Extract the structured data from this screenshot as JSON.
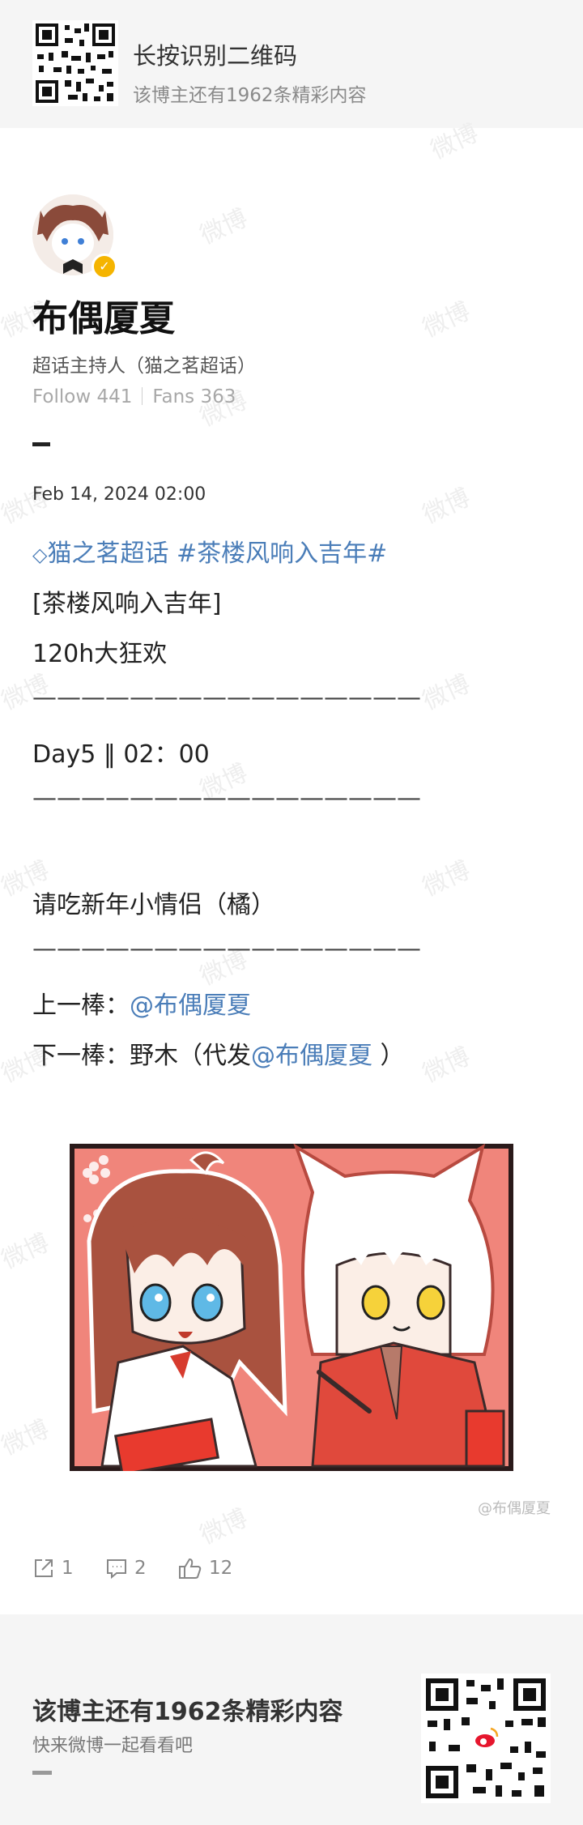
{
  "banner": {
    "title": "长按识别二维码",
    "subtitle": "该博主还有1962条精彩内容"
  },
  "watermark_text": "微博",
  "profile": {
    "name": "布偶厦夏",
    "role": "超话主持人（猫之茗超话）",
    "follow": "Follow 441",
    "fans": "Fans 363",
    "verified_icon": "verified-badge-icon"
  },
  "post": {
    "date": "Feb 14, 2024 02:00",
    "topic_supertopic": "猫之茗超话",
    "topic_hashtag": " #茶楼风响入吉年#",
    "lines": {
      "l1": "[茶楼风响入吉年]",
      "l2": "120h大狂欢",
      "sep": "————————————————",
      "l3": "Day5 ‖ 02：00",
      "l4": "请吃新年小情侣（橘）",
      "prev_label": "上一棒：",
      "prev_mention": "@布偶厦夏",
      "next_label": "下一棒：野木（代发",
      "next_mention": "@布偶厦夏",
      "next_end": " ）"
    },
    "image_watermark": "@布偶厦夏"
  },
  "actions": {
    "repost": "1",
    "comment": "2",
    "like": "12"
  },
  "footer": {
    "title": "该博主还有1962条精彩内容",
    "subtitle": "快来微博一起看看吧"
  },
  "colors": {
    "link": "#4a7db8",
    "banner_bg": "#f5f5f5",
    "illustration_bg": "#f0857b"
  }
}
